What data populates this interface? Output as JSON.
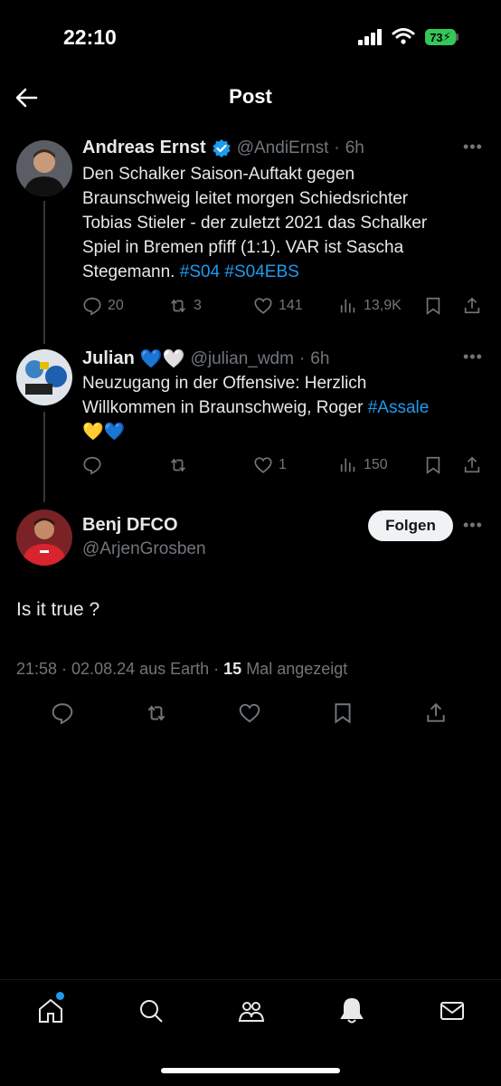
{
  "status_bar": {
    "time": "22:10",
    "battery": "73"
  },
  "header": {
    "title": "Post"
  },
  "tweets": [
    {
      "name": "Andreas Ernst",
      "handle": "@AndiErnst",
      "sep": "·",
      "time": "6h",
      "text_lines": [
        "Den Schalker Saison-Auftakt gegen",
        "Braunschweig leitet morgen Schiedsrichter",
        "Tobias Stieler - der zuletzt 2021 das Schalker",
        "Spiel in Bremen pfiff (1:1). VAR ist Sascha",
        "Stegemann."
      ],
      "hashtags": [
        "#S04",
        "#S04EBS"
      ],
      "replies": "20",
      "reposts": "3",
      "likes": "141",
      "views": "13,9K"
    },
    {
      "name": "Julian",
      "name_emoji": "💙🤍",
      "handle": "@julian_wdm",
      "sep": "·",
      "time": "6h",
      "text_lines": [
        "Neuzugang in der Offensive: Herzlich",
        "Willkommen in Braunschweig, Roger"
      ],
      "hashtag": "#Assale",
      "emoji_line": "💛💙",
      "replies": "",
      "reposts": "",
      "likes": "1",
      "views": "150"
    }
  ],
  "main_post": {
    "name": "Benj DFCO",
    "handle": "@ArjenGrosben",
    "follow_label": "Folgen",
    "text": "Is it true ?",
    "meta_prefix": "21:58 · 02.08.24 aus Earth · ",
    "view_count": "15",
    "meta_suffix": " Mal angezeigt"
  },
  "colors": {
    "accent": "#1d9bf0",
    "background": "#000000",
    "muted": "#71767b",
    "verified": "#1d9bf0",
    "battery": "#34c759"
  },
  "icons": [
    "back-arrow-icon",
    "verified-badge-icon",
    "reply-icon",
    "repost-icon",
    "like-icon",
    "views-icon",
    "bookmark-icon",
    "share-icon",
    "home-icon",
    "search-icon",
    "communities-icon",
    "notifications-icon",
    "messages-icon"
  ]
}
